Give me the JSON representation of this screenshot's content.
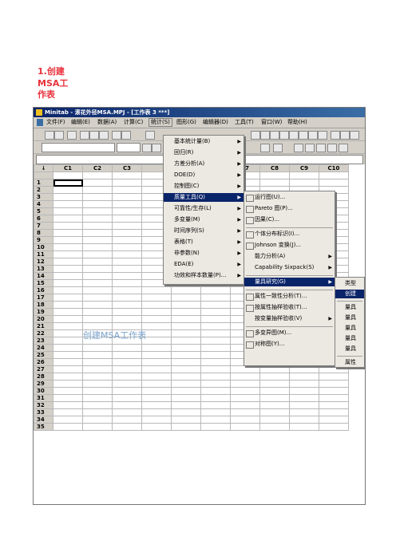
{
  "heading": {
    "line1": "1.创建",
    "line2": "MSA工",
    "line3": "作表"
  },
  "window": {
    "title": "Minitab - 滚花外径MSA.MPJ - [工作表 3 ***]"
  },
  "menubar": [
    "文件(F)",
    "编辑(E)",
    "数据(A)",
    "计算(C)",
    "统计(S)",
    "图形(G)",
    "编辑器(D)",
    "工具(T)",
    "窗口(W)",
    "帮助(H)"
  ],
  "columns": [
    "C1",
    "C2",
    "C3",
    "C7",
    "C8",
    "C9",
    "C10"
  ],
  "corner": "↓",
  "rows": [
    "1",
    "2",
    "3",
    "4",
    "5",
    "6",
    "7",
    "8",
    "9",
    "10",
    "11",
    "12",
    "13",
    "14",
    "15",
    "16",
    "17",
    "18",
    "19",
    "20",
    "21",
    "22",
    "23",
    "24",
    "25",
    "26",
    "27",
    "28",
    "29",
    "30",
    "31",
    "32",
    "33",
    "34",
    "35"
  ],
  "stat_menu": [
    {
      "label": "基本统计量(B)"
    },
    {
      "label": "回归(R)"
    },
    {
      "label": "方差分析(A)"
    },
    {
      "label": "DOE(D)"
    },
    {
      "label": "控制图(C)"
    },
    {
      "label": "质量工具(Q)"
    },
    {
      "label": "可靠性/生存(L)"
    },
    {
      "label": "多变量(M)"
    },
    {
      "label": "时间序列(S)"
    },
    {
      "label": "表格(T)"
    },
    {
      "label": "非参数(N)"
    },
    {
      "label": "EDA(E)"
    },
    {
      "label": "功效和样本数量(P)..."
    }
  ],
  "quality_menu": [
    {
      "label": "运行图(U)...",
      "icon": "run-chart-icon"
    },
    {
      "label": "Pareto 图(P)...",
      "icon": "pareto-icon"
    },
    {
      "label": "因果(C)...",
      "icon": "cause-effect-icon"
    },
    {
      "label": "个体分布标识(I)...",
      "icon": "distribution-icon"
    },
    {
      "label": "Johnson 变换(J)...",
      "icon": "johnson-icon"
    },
    {
      "label": "能力分析(A)",
      "icon": ""
    },
    {
      "label": "Capability Sixpack(S)",
      "icon": ""
    },
    {
      "label": "量具研究(G)",
      "icon": ""
    },
    {
      "label": "属性一致性分析(T)...",
      "icon": "attribute-agreement-icon"
    },
    {
      "label": "按属性抽样验收(T)...",
      "icon": "acceptance-sampling-icon"
    },
    {
      "label": "按变量抽样验收(V)",
      "icon": ""
    },
    {
      "label": "多变异图(M)...",
      "icon": "multivari-icon"
    },
    {
      "label": "对称图(Y)...",
      "icon": "symmetry-icon"
    }
  ],
  "gage_menu": [
    {
      "label": "类型"
    },
    {
      "label": "创建"
    },
    {
      "label": "量具"
    },
    {
      "label": "量具"
    },
    {
      "label": "量具"
    },
    {
      "label": "量具"
    },
    {
      "label": "量具"
    },
    {
      "label": "属性"
    }
  ],
  "annotation": "创建MSA工作表"
}
